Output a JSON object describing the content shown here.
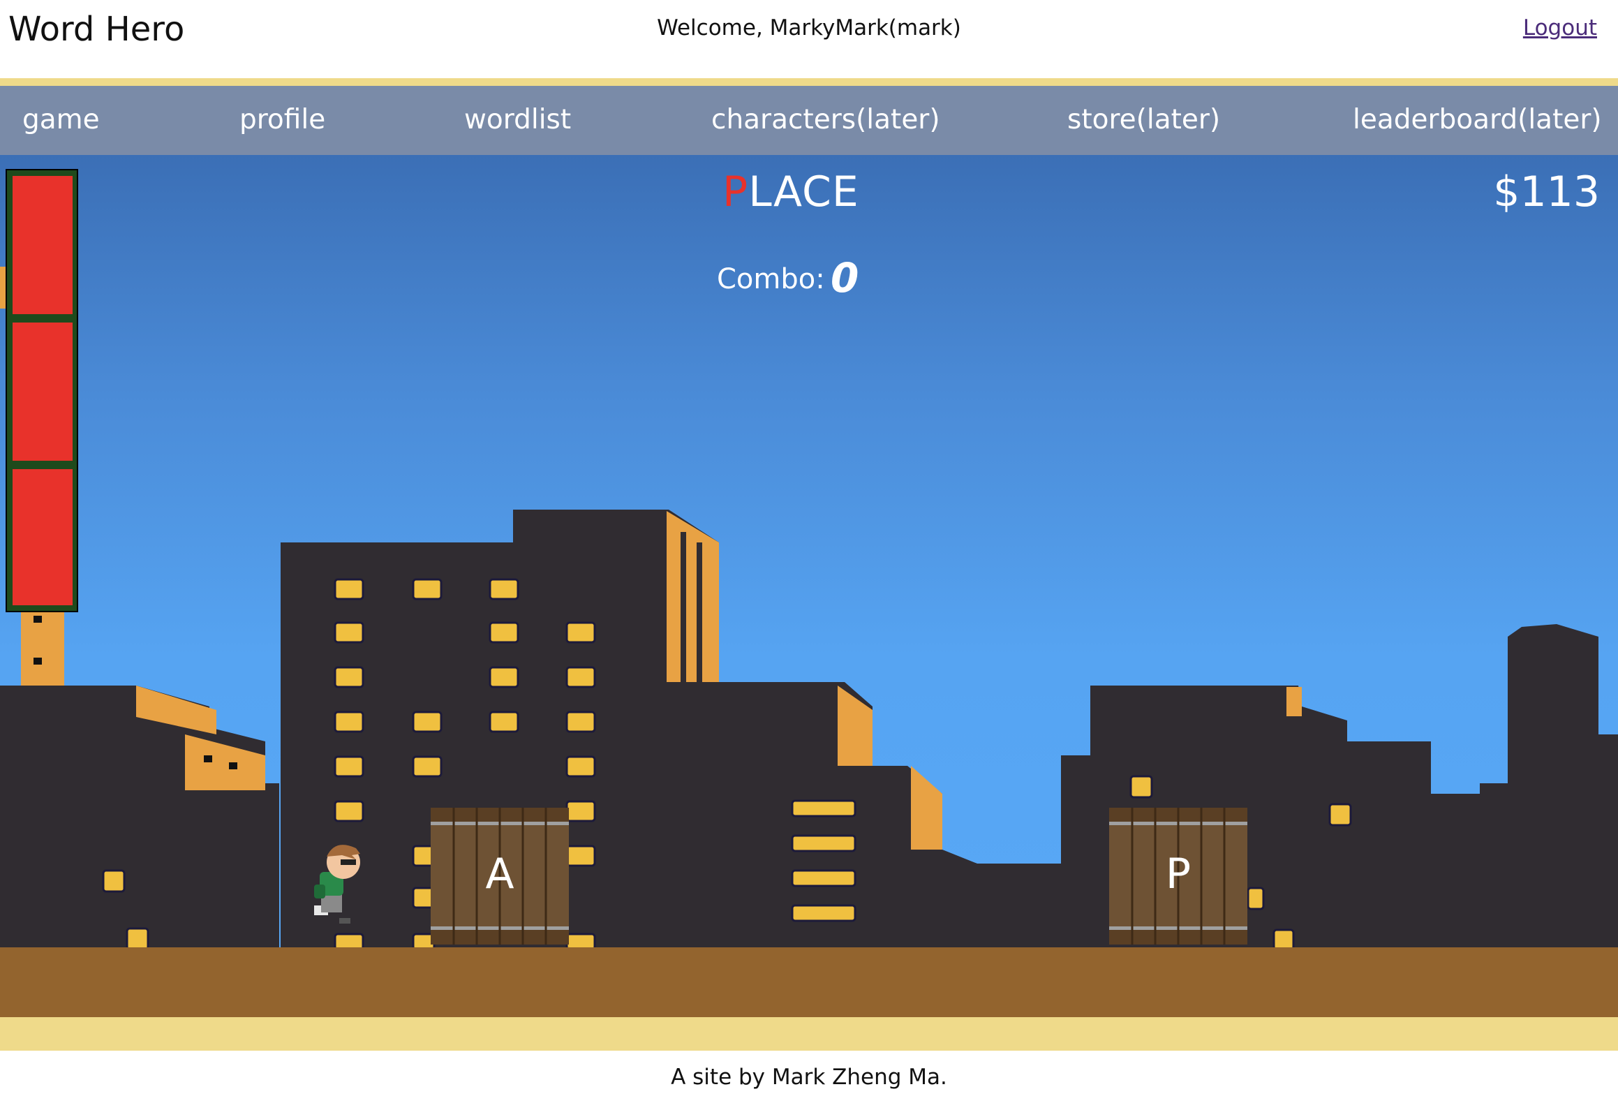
{
  "header": {
    "site_title": "Word Hero",
    "welcome": "Welcome, MarkyMark(mark)",
    "logout": "Logout"
  },
  "nav": {
    "items": [
      {
        "label": "game"
      },
      {
        "label": "profile"
      },
      {
        "label": "wordlist"
      },
      {
        "label": "characters(later)"
      },
      {
        "label": "store(later)"
      },
      {
        "label": "leaderboard(later)"
      }
    ]
  },
  "game": {
    "word_first_letter": "P",
    "word_rest": "LACE",
    "money": "$113",
    "combo_label": "Combo:",
    "combo_value": "0",
    "health_segments": 3,
    "crates": [
      {
        "letter": "A"
      },
      {
        "letter": "P"
      }
    ]
  },
  "footer": {
    "text": "A site by Mark Zheng Ma."
  },
  "colors": {
    "nav_bg": "#7a8ba8",
    "accent_yellow": "#efda8a",
    "health_red": "#e8322b",
    "health_green": "#2f7a2a",
    "ground_brown": "#93642e",
    "building_dark": "#302c31",
    "window_yellow": "#f0c040"
  }
}
